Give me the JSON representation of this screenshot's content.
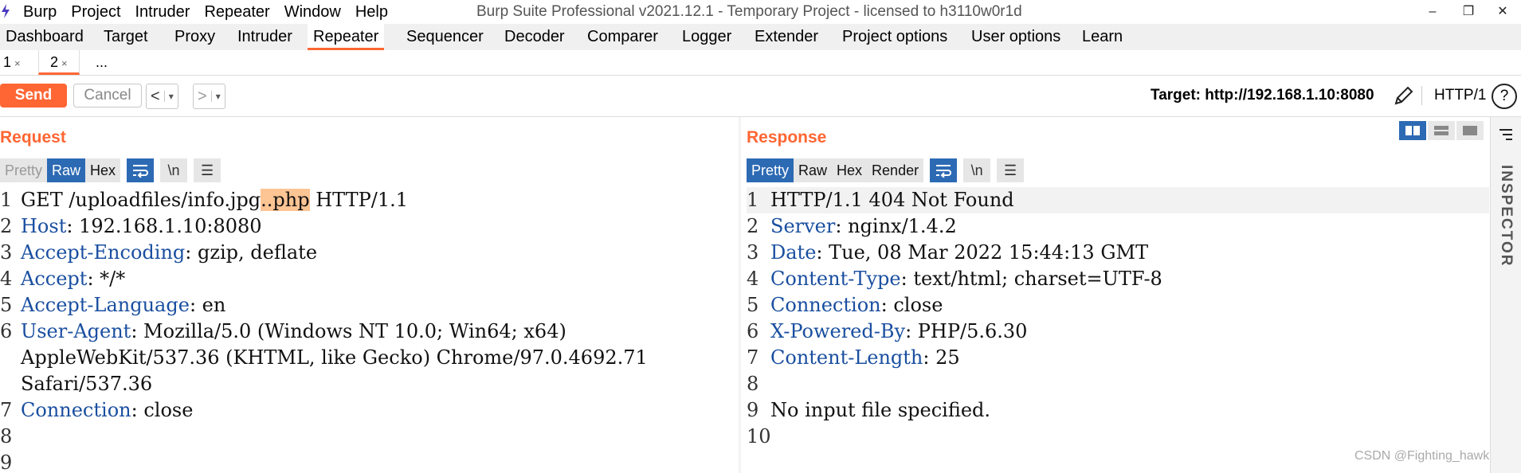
{
  "menubar": {
    "items": [
      "Burp",
      "Project",
      "Intruder",
      "Repeater",
      "Window",
      "Help"
    ],
    "window_title": "Burp Suite Professional v2021.12.1 - Temporary Project - licensed to h3110w0r1d",
    "minimize": "–",
    "restore": "❐",
    "close": "✕"
  },
  "main_tabs": [
    "Dashboard",
    "Target",
    "Proxy",
    "Intruder",
    "Repeater",
    "Sequencer",
    "Decoder",
    "Comparer",
    "Logger",
    "Extender",
    "Project options",
    "User options",
    "Learn"
  ],
  "active_main_tab": "Repeater",
  "sub_tabs": [
    {
      "label": "1",
      "close": "×"
    },
    {
      "label": "2",
      "close": "×"
    },
    {
      "label": "..."
    }
  ],
  "toolbar": {
    "send_label": "Send",
    "cancel_label": "Cancel",
    "back": "<",
    "forward": ">",
    "dropdown": "▾",
    "target_label": "Target: http://192.168.1.10:8080",
    "protocol": "HTTP/1",
    "help": "?"
  },
  "request": {
    "title": "Request",
    "tabs": [
      "Pretty",
      "Raw",
      "Hex"
    ],
    "active_tab": "Raw",
    "icon_wrap": "wrap-icon",
    "icon_newline": "\\n",
    "icon_menu": "☰",
    "lines": [
      {
        "n": "1",
        "pre": "GET /uploadfiles/info.jpg",
        "hl": "..php",
        "post": " HTTP/1.1"
      },
      {
        "n": "2",
        "name": "Host",
        "value": ": 192.168.1.10:8080"
      },
      {
        "n": "3",
        "name": "Accept-Encoding",
        "value": ": gzip, deflate"
      },
      {
        "n": "4",
        "name": "Accept",
        "value": ": */*"
      },
      {
        "n": "5",
        "name": "Accept-Language",
        "value": ": en"
      },
      {
        "n": "6",
        "name": "User-Agent",
        "value": ": Mozilla/5.0 (Windows NT 10.0; Win64; x64)"
      },
      {
        "n": "",
        "text": "AppleWebKit/537.36 (KHTML, like Gecko) Chrome/97.0.4692.71"
      },
      {
        "n": "",
        "text": "Safari/537.36"
      },
      {
        "n": "7",
        "name": "Connection",
        "value": ": close"
      },
      {
        "n": "8",
        "text": ""
      },
      {
        "n": "9",
        "text": ""
      }
    ]
  },
  "response": {
    "title": "Response",
    "tabs": [
      "Pretty",
      "Raw",
      "Hex",
      "Render"
    ],
    "active_tab": "Pretty",
    "icon_newline": "\\n",
    "icon_menu": "☰",
    "lines": [
      {
        "n": "1",
        "text": "HTTP/1.1 404 Not Found"
      },
      {
        "n": "2",
        "name": "Server",
        "value": ": nginx/1.4.2"
      },
      {
        "n": "3",
        "name": "Date",
        "value": ": Tue, 08 Mar 2022 15:44:13 GMT"
      },
      {
        "n": "4",
        "name": "Content-Type",
        "value": ": text/html; charset=UTF-8"
      },
      {
        "n": "5",
        "name": "Connection",
        "value": ": close"
      },
      {
        "n": "6",
        "name": "X-Powered-By",
        "value": ": PHP/5.6.30"
      },
      {
        "n": "7",
        "name": "Content-Length",
        "value": ": 25"
      },
      {
        "n": "8",
        "text": ""
      },
      {
        "n": "9",
        "text": "No input file specified."
      },
      {
        "n": "10",
        "text": ""
      }
    ]
  },
  "inspector": {
    "label": "INSPECTOR"
  },
  "watermark": "CSDN @Fighting_hawk",
  "colors": {
    "accent": "#ff6633",
    "active_blue": "#2d6ab4",
    "header_name": "#1a4fa0",
    "highlight": "#fdc494"
  }
}
